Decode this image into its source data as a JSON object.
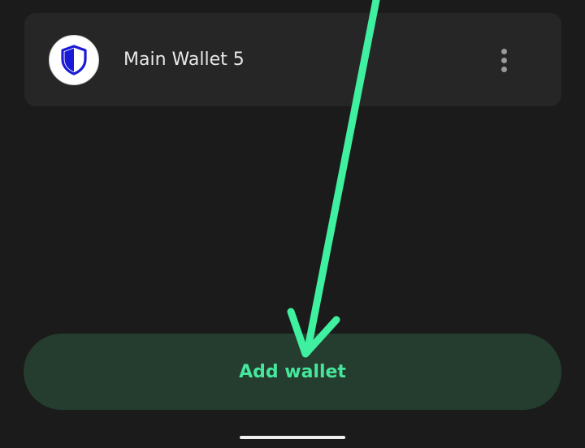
{
  "wallet": {
    "name": "Main Wallet 5",
    "avatar_icon": "shield-icon",
    "menu_icon": "more-vertical-icon"
  },
  "actions": {
    "add_wallet_label": "Add wallet"
  },
  "colors": {
    "background": "#1b1b1b",
    "card": "#262626",
    "accent_green": "#46e69c",
    "button_bg": "#243d2e",
    "shield_blue": "#1a1ad6",
    "annotation_arrow": "#3ef0a0"
  }
}
